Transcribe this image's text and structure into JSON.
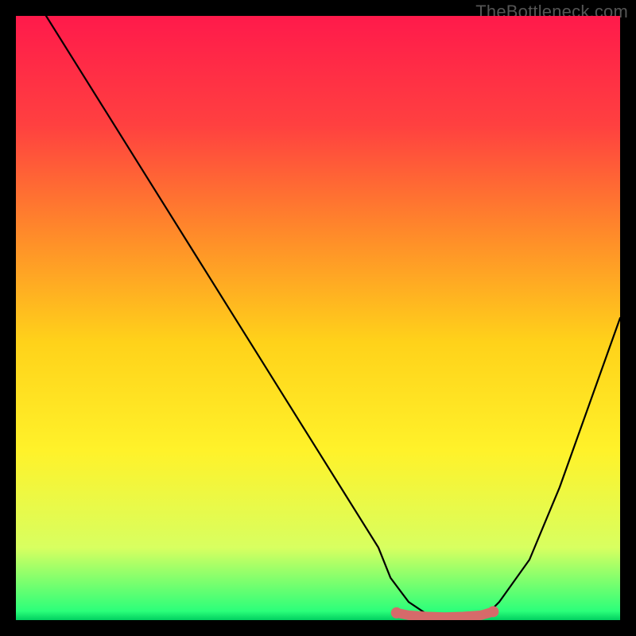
{
  "attribution": "TheBottleneck.com",
  "chart_data": {
    "type": "line",
    "title": "",
    "xlabel": "",
    "ylabel": "",
    "xlim": [
      0,
      100
    ],
    "ylim": [
      0,
      100
    ],
    "grid": false,
    "legend": false,
    "background_gradient": {
      "stops": [
        {
          "offset": 0.0,
          "color": "#ff1a4b"
        },
        {
          "offset": 0.18,
          "color": "#ff4040"
        },
        {
          "offset": 0.36,
          "color": "#ff8a2a"
        },
        {
          "offset": 0.54,
          "color": "#ffd21a"
        },
        {
          "offset": 0.72,
          "color": "#fff22a"
        },
        {
          "offset": 0.88,
          "color": "#d8ff60"
        },
        {
          "offset": 0.985,
          "color": "#2cff7a"
        },
        {
          "offset": 1.0,
          "color": "#00d060"
        }
      ]
    },
    "curve": {
      "x": [
        5,
        10,
        15,
        20,
        25,
        30,
        35,
        40,
        45,
        50,
        55,
        60,
        62,
        65,
        68,
        72,
        75,
        78,
        80,
        85,
        90,
        95,
        100
      ],
      "y": [
        100,
        92,
        84,
        76,
        68,
        60,
        52,
        44,
        36,
        28,
        20,
        12,
        7,
        3,
        1,
        0.5,
        0.5,
        1,
        3,
        10,
        22,
        36,
        50
      ]
    },
    "highlight": {
      "color": "#d66a6a",
      "x": [
        63,
        65,
        68,
        71,
        74,
        77,
        79
      ],
      "y": [
        1.2,
        0.8,
        0.6,
        0.5,
        0.6,
        0.8,
        1.4
      ]
    }
  }
}
